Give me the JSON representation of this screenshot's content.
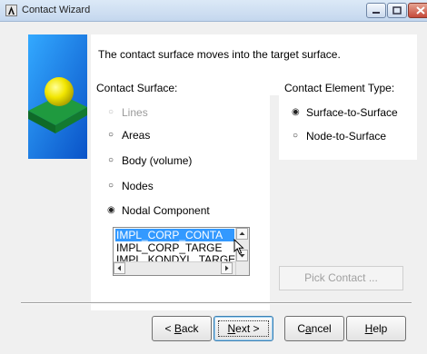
{
  "window": {
    "title": "Contact Wizard",
    "controls": [
      "minimize",
      "maximize",
      "close"
    ]
  },
  "description": "The contact surface moves into the target surface.",
  "contact_surface": {
    "label": "Contact Surface:",
    "options": [
      {
        "label": "Lines",
        "selected": false,
        "enabled": false
      },
      {
        "label": "Areas",
        "selected": false,
        "enabled": true
      },
      {
        "label": "Body (volume)",
        "selected": false,
        "enabled": true
      },
      {
        "label": "Nodes",
        "selected": false,
        "enabled": true
      },
      {
        "label": "Nodal Component",
        "selected": true,
        "enabled": true
      }
    ],
    "components": [
      "IMPL_CORP_CONTA",
      "IMPL_CORP_TARGE",
      "IMPL_KONDYL_TARGE"
    ],
    "selected_component": "IMPL_CORP_CONTA"
  },
  "element_type": {
    "label": "Contact Element Type:",
    "options": [
      {
        "label": "Surface-to-Surface",
        "selected": true
      },
      {
        "label": "Node-to-Surface",
        "selected": false
      }
    ]
  },
  "pick_contact": {
    "label": "Pick Contact ...",
    "enabled": false
  },
  "buttons": {
    "back": {
      "label": "< Back",
      "mnemonic": "B"
    },
    "next": {
      "label": "Next >",
      "mnemonic": "N",
      "default": true
    },
    "cancel": {
      "label": "Cancel",
      "mnemonic": "a"
    },
    "help": {
      "label": "Help",
      "mnemonic": "H"
    }
  },
  "colors": {
    "title_bar": "#cfdff2",
    "selection": "#3399ff",
    "graphic_panel": "#1e90ff",
    "sphere": "#f0e000",
    "plate": "#1a8a3a",
    "disabled_text": "#9a9a9a"
  },
  "icons": [
    "app-logo-icon",
    "minimize-icon",
    "maximize-icon",
    "close-icon",
    "mouse-pointer-icon"
  ]
}
